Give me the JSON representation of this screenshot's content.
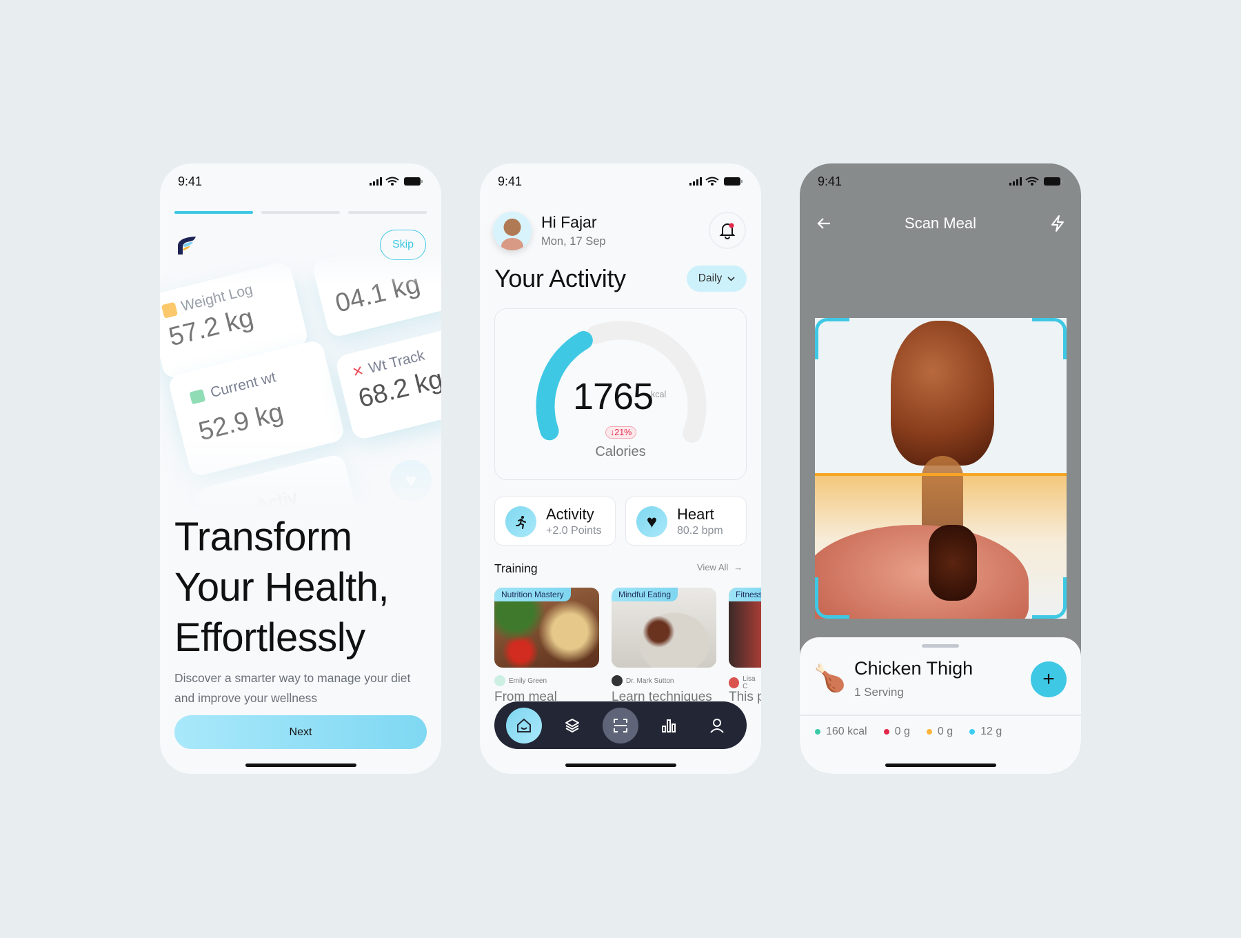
{
  "status_time": "9:41",
  "onboarding": {
    "skip_label": "Skip",
    "progress_steps": 3,
    "active_step": 1,
    "cards": [
      {
        "label": "Weight Log",
        "value": "57.2 kg"
      },
      {
        "label": "",
        "value": "04.1 kg"
      },
      {
        "label": "Current wt",
        "value": "52.9 kg"
      },
      {
        "label": "Wt Track",
        "value": "68.2 kg"
      },
      {
        "label": "",
        "value": "Activ"
      }
    ],
    "title_lines": [
      "Transform",
      "Your Health,",
      "Effortlessly"
    ],
    "description": "Discover a smarter way to manage your diet and improve your wellness",
    "next_label": "Next"
  },
  "dashboard": {
    "greeting": "Hi Fajar",
    "date": "Mon, 17 Sep",
    "section_title": "Your Activity",
    "period_select": "Daily",
    "calories": {
      "value": "1765",
      "unit": "kcal",
      "change": "21%",
      "label": "Calories",
      "progress": 0.36
    },
    "stats": [
      {
        "title": "Activity",
        "sub": "+2.0 Points",
        "icon": "running-icon"
      },
      {
        "title": "Heart",
        "sub": "80.2 bpm",
        "icon": "heart-icon"
      }
    ],
    "training_title": "Training",
    "view_all": "View All",
    "training": [
      {
        "tag": "Nutrition Mastery",
        "author": "Emily Green",
        "desc": "From meal"
      },
      {
        "tag": "Mindful Eating",
        "author": "Dr. Mark Sutton",
        "desc": "Learn techniques"
      },
      {
        "tag": "Fitness",
        "author": "Lisa C",
        "desc": "This p"
      }
    ],
    "nav": [
      "home-icon",
      "layers-icon",
      "scan-icon",
      "chart-icon",
      "user-icon"
    ]
  },
  "scan": {
    "title": "Scan Meal",
    "food_name": "Chicken Thigh",
    "serving": "1 Serving",
    "macros": [
      {
        "value": "160 kcal",
        "color": "#3cc9a8"
      },
      {
        "value": "0 g",
        "color": "#e3264a"
      },
      {
        "value": "0 g",
        "color": "#fbb43a"
      },
      {
        "value": "12 g",
        "color": "#3ccdf2"
      }
    ]
  },
  "colors": {
    "accent": "#3ec8e4",
    "background": "#e8edf0"
  }
}
